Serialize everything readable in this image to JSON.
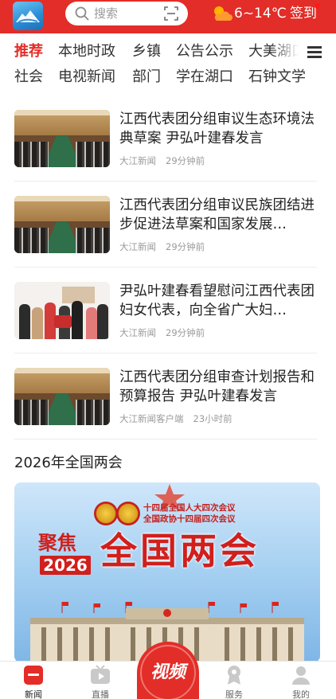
{
  "header": {
    "search_placeholder": "搜索",
    "weather_temp": "6~14℃",
    "signin_label": "签到",
    "colors": {
      "brand_red": "#e32d28"
    }
  },
  "tabs": {
    "row1": [
      "推荐",
      "本地时政",
      "乡镇",
      "公告公示",
      "大美湖口"
    ],
    "row2": [
      "社会",
      "电视新闻",
      "部门",
      "学在湖口",
      "石钟文学"
    ],
    "active": "推荐"
  },
  "news": [
    {
      "title": "江西代表团分组审议生态环境法典草案 尹弘叶建春发言",
      "source": "大江新闻",
      "time": "29分钟前"
    },
    {
      "title": "江西代表团分组审议民族团结进步促进法草案和国家发展…",
      "source": "大江新闻",
      "time": "29分钟前"
    },
    {
      "title": "尹弘叶建春看望慰问江西代表团妇女代表，向全省广大妇…",
      "source": "大江新闻",
      "time": "29分钟前"
    },
    {
      "title": "江西代表团分组审查计划报告和预算报告 尹弘叶建春发言",
      "source": "大江新闻客户端",
      "time": "23小时前"
    }
  ],
  "section": {
    "title": "2026年全国两会",
    "banner": {
      "line1": "十四届全国人大四次会议",
      "line2": "全国政协十四届四次会议",
      "focus": "聚焦",
      "year": "2026",
      "main": "全国两会"
    }
  },
  "bottom_nav": {
    "items": [
      "新闻",
      "直播",
      "服务",
      "我的"
    ],
    "video_label": "视频",
    "active": "新闻"
  }
}
